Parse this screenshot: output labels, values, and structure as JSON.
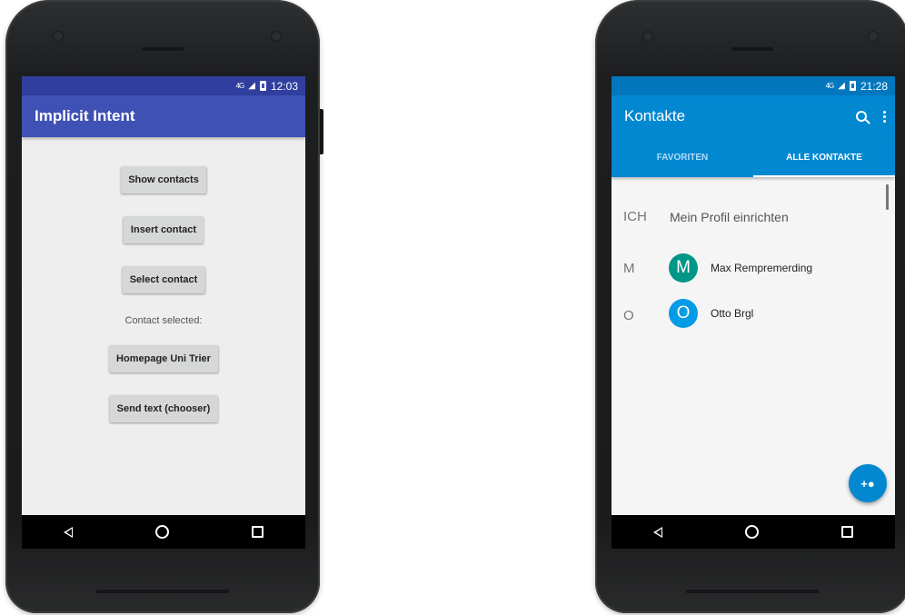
{
  "left_phone": {
    "status": {
      "network": "4G",
      "time": "12:03"
    },
    "app_title": "Implicit Intent",
    "buttons": {
      "show_contacts": "Show contacts",
      "insert_contact": "Insert contact",
      "select_contact": "Select contact",
      "homepage": "Homepage Uni Trier",
      "send_text": "Send text (chooser)"
    },
    "contact_selected_label": "Contact selected:",
    "colors": {
      "primary": "#3f51b5",
      "primary_dark": "#303f9f",
      "background": "#eeeeee"
    }
  },
  "right_phone": {
    "status": {
      "network": "4G",
      "time": "21:28"
    },
    "app_title": "Kontakte",
    "tabs": [
      {
        "label": "FAVORITEN",
        "active": false
      },
      {
        "label": "ALLE KONTAKTE",
        "active": true
      }
    ],
    "profile": {
      "section": "ICH",
      "text": "Mein Profil einrichten"
    },
    "contacts": [
      {
        "section": "M",
        "initial": "M",
        "name": "Max Rempremerding",
        "color": "#009688"
      },
      {
        "section": "O",
        "initial": "O",
        "name": "Otto Brgl",
        "color": "#039be5"
      }
    ],
    "icons": {
      "search": "search-icon",
      "more": "more-vert-icon",
      "fab": "add-contact-icon"
    },
    "colors": {
      "primary": "#0288d1",
      "primary_dark": "#0277bd"
    }
  },
  "navbar": {
    "icons": [
      "back-icon",
      "home-icon",
      "recents-icon"
    ]
  }
}
